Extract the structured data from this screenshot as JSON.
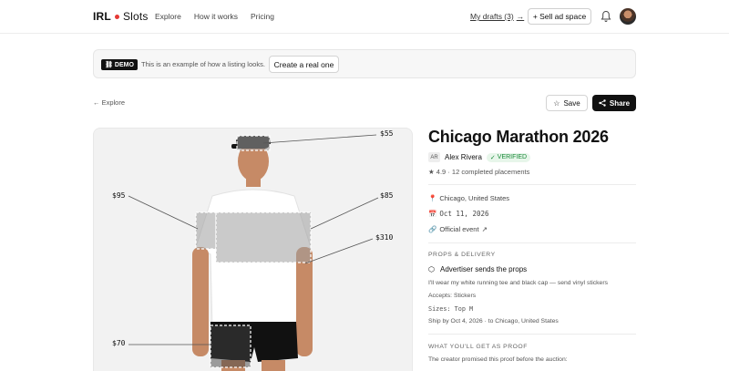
{
  "nav": {
    "brand_left": "IRL",
    "brand_right": "Slots",
    "links": [
      "Explore",
      "How it works",
      "Pricing"
    ],
    "drafts_label": "My drafts (3)",
    "sell_label": "+ Sell ad space"
  },
  "banner": {
    "badge": "DEMO",
    "text": "This is an example of how a listing looks.",
    "button": "Create a real one"
  },
  "breadcrumb": "← Explore",
  "actions": {
    "save": "Save",
    "share": "Share"
  },
  "slots": {
    "cap": "$55",
    "left_sleeve": "$95",
    "right_sleeve": "$85",
    "chest": "$310",
    "shorts": "$70"
  },
  "listing": {
    "title": "Chicago Marathon 2026",
    "creator_initials": "AR",
    "creator_name": "Alex Rivera",
    "verified": "VERIFIED",
    "rating": "★ 4.9 · 12 completed placements",
    "location": "Chicago, United States",
    "date": "Oct 11, 2026",
    "official": "Official event",
    "props_heading": "PROPS & DELIVERY",
    "props_mode": "Advertiser sends the props",
    "props_desc": "I'll wear my white running tee and black cap — send vinyl stickers",
    "accepts": "Accepts: Stickers",
    "sizes": "Sizes: Top M",
    "ship_by": "Ship by Oct 4, 2026 · to Chicago, United States",
    "proof_heading": "WHAT YOU'LL GET AS PROOF",
    "proof_desc": "The creator promised this proof before the auction:"
  },
  "colors": {
    "accent_dot": "#e53935",
    "verified_green": "#1b8a3a",
    "primary_dark": "#111111"
  },
  "icons": [
    "bell-icon",
    "avatar",
    "star-icon",
    "pin-icon",
    "calendar-icon",
    "link-icon",
    "box-icon",
    "arrow-right-icon",
    "external-link-icon"
  ]
}
